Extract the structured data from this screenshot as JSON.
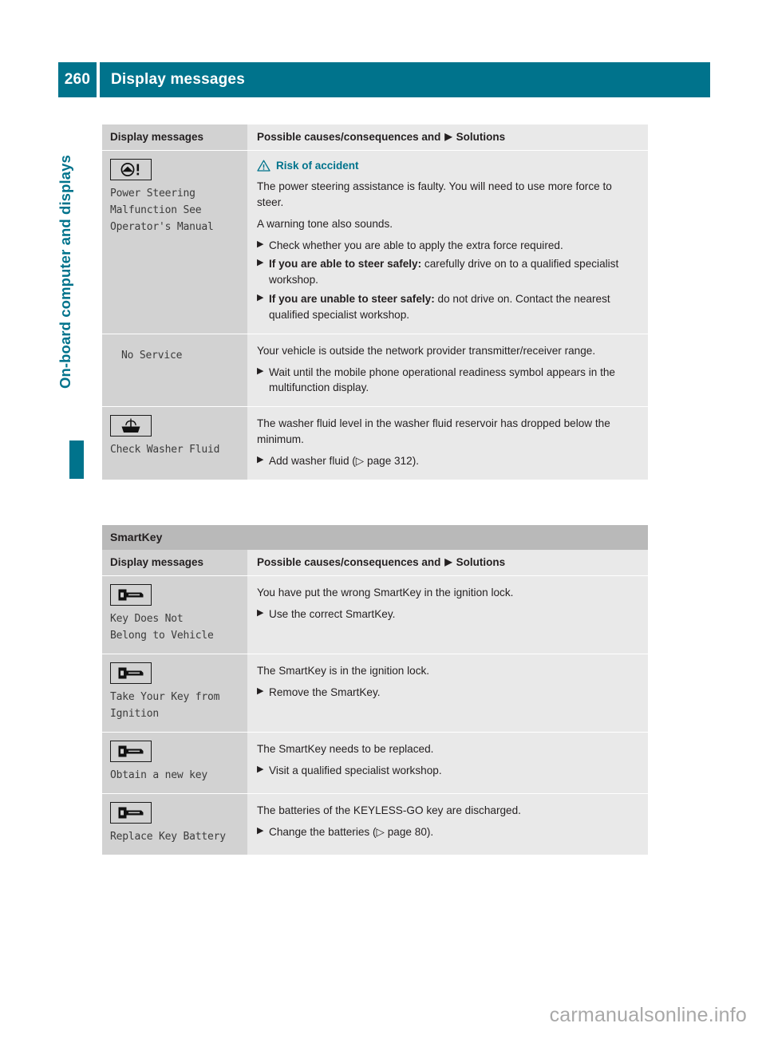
{
  "header": {
    "page_number": "260",
    "title": "Display messages"
  },
  "side_tab": {
    "label": "On-board computer and displays"
  },
  "watermark": "carmanualsonline.info",
  "table_one": {
    "columns": {
      "left": "Display messages",
      "right_before": "Possible causes/consequences and",
      "right_arrow": "▶",
      "right_after": "Solutions"
    },
    "rows": [
      {
        "icon": "power-steering-warning-icon",
        "message": "Power Steering\nMalfunction See\nOperator's Manual",
        "warning": {
          "icon": "warning-triangle-icon",
          "label": "Risk of accident"
        },
        "paragraphs": [
          "The power steering assistance is faulty. You will need to use more force to steer.",
          "A warning tone also sounds."
        ],
        "bullets": [
          {
            "mark": "▶",
            "bold": "",
            "text": "Check whether you are able to apply the extra force required."
          },
          {
            "mark": "▶",
            "bold": "If you are able to steer safely:",
            "text": " carefully drive on to a qualified specialist workshop."
          },
          {
            "mark": "▶",
            "bold": "If you are unable to steer safely:",
            "text": " do not drive on. Contact the nearest qualified specialist workshop."
          }
        ]
      },
      {
        "icon": "",
        "message": "No Service",
        "warning": null,
        "paragraphs": [
          "Your vehicle is outside the network provider transmitter/receiver range."
        ],
        "bullets": [
          {
            "mark": "▶",
            "bold": "",
            "text": "Wait until the mobile phone operational readiness symbol appears in the multifunction display."
          }
        ]
      },
      {
        "icon": "washer-fluid-icon",
        "message": "Check Washer Fluid",
        "warning": null,
        "paragraphs": [
          "The washer fluid level in the washer fluid reservoir has dropped below the minimum."
        ],
        "bullets": [
          {
            "mark": "▶",
            "bold": "",
            "text": "Add washer fluid (▷ page 312)."
          }
        ]
      }
    ]
  },
  "table_two": {
    "section_title": "SmartKey",
    "columns": {
      "left": "Display messages",
      "right_before": "Possible causes/consequences and",
      "right_arrow": "▶",
      "right_after": "Solutions"
    },
    "rows": [
      {
        "icon": "smartkey-icon",
        "message": "Key Does Not\nBelong to Vehicle",
        "paragraphs": [
          "You have put the wrong SmartKey in the ignition lock."
        ],
        "bullets": [
          {
            "mark": "▶",
            "bold": "",
            "text": "Use the correct SmartKey."
          }
        ]
      },
      {
        "icon": "smartkey-icon",
        "message": "Take Your Key from\nIgnition",
        "paragraphs": [
          "The SmartKey is in the ignition lock."
        ],
        "bullets": [
          {
            "mark": "▶",
            "bold": "",
            "text": "Remove the SmartKey."
          }
        ]
      },
      {
        "icon": "smartkey-icon",
        "message": "Obtain a new key",
        "paragraphs": [
          "The SmartKey needs to be replaced."
        ],
        "bullets": [
          {
            "mark": "▶",
            "bold": "",
            "text": "Visit a qualified specialist workshop."
          }
        ]
      },
      {
        "icon": "smartkey-icon",
        "message": "Replace Key Battery",
        "paragraphs": [
          "The batteries of the KEYLESS-GO key are discharged."
        ],
        "bullets": [
          {
            "mark": "▶",
            "bold": "",
            "text": "Change the batteries (▷ page 80)."
          }
        ]
      }
    ]
  },
  "colors": {
    "brand_teal": "#00738c",
    "left_column_gray": "#d2d2d2",
    "right_column_gray": "#e9e9e9",
    "section_band_gray": "#b9b9b9"
  }
}
